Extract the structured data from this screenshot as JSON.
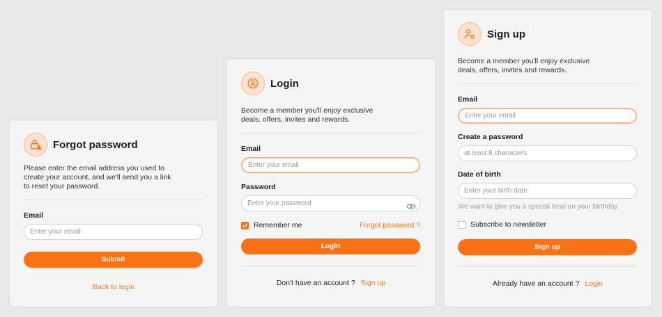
{
  "forgot": {
    "title": "Forgot password",
    "description": "Please enter the email address you used to create your account, and we'll send you a link to reset your password.",
    "email_label": "Email",
    "email_placeholder": "Enter your email",
    "submit_label": "Submit",
    "back_link": "Back to login",
    "icon": "lock-warning-icon"
  },
  "login": {
    "title": "Login",
    "description": "Become a member you'll enjoy exclusive deals, offers, invites and rewards.",
    "email_label": "Email",
    "email_placeholder": "Enter your email",
    "password_label": "Password",
    "password_placeholder": "Enter your password",
    "remember_label": "Remember me",
    "remember_checked": true,
    "forgot_link": "Forgot password ?",
    "login_button": "Login",
    "no_account_text": "Don't have an account ?",
    "signup_link": "Sign up",
    "icon": "user-circle-icon"
  },
  "signup": {
    "title": "Sign up",
    "description": "Become a member you'll enjoy exclusive deals, offers, invites and rewards.",
    "email_label": "Email",
    "email_placeholder": "Enter your email",
    "password_label": "Create a password",
    "password_placeholder": "at least 8 characters",
    "dob_label": "Date of birth",
    "dob_placeholder": "Enter your birth date",
    "dob_hint": "We want to give you a special treat on your birthday",
    "newsletter_label": "Subscribe to newsletter",
    "newsletter_checked": false,
    "signup_button": "Sign up",
    "have_account_text": "Already have an account ?",
    "login_link": "Login",
    "icon": "user-add-icon"
  },
  "colors": {
    "accent": "#f97316",
    "accent_light": "#fde2cf",
    "link": "#f07a22",
    "background": "#e8e8e8",
    "card": "#f5f5f5"
  }
}
